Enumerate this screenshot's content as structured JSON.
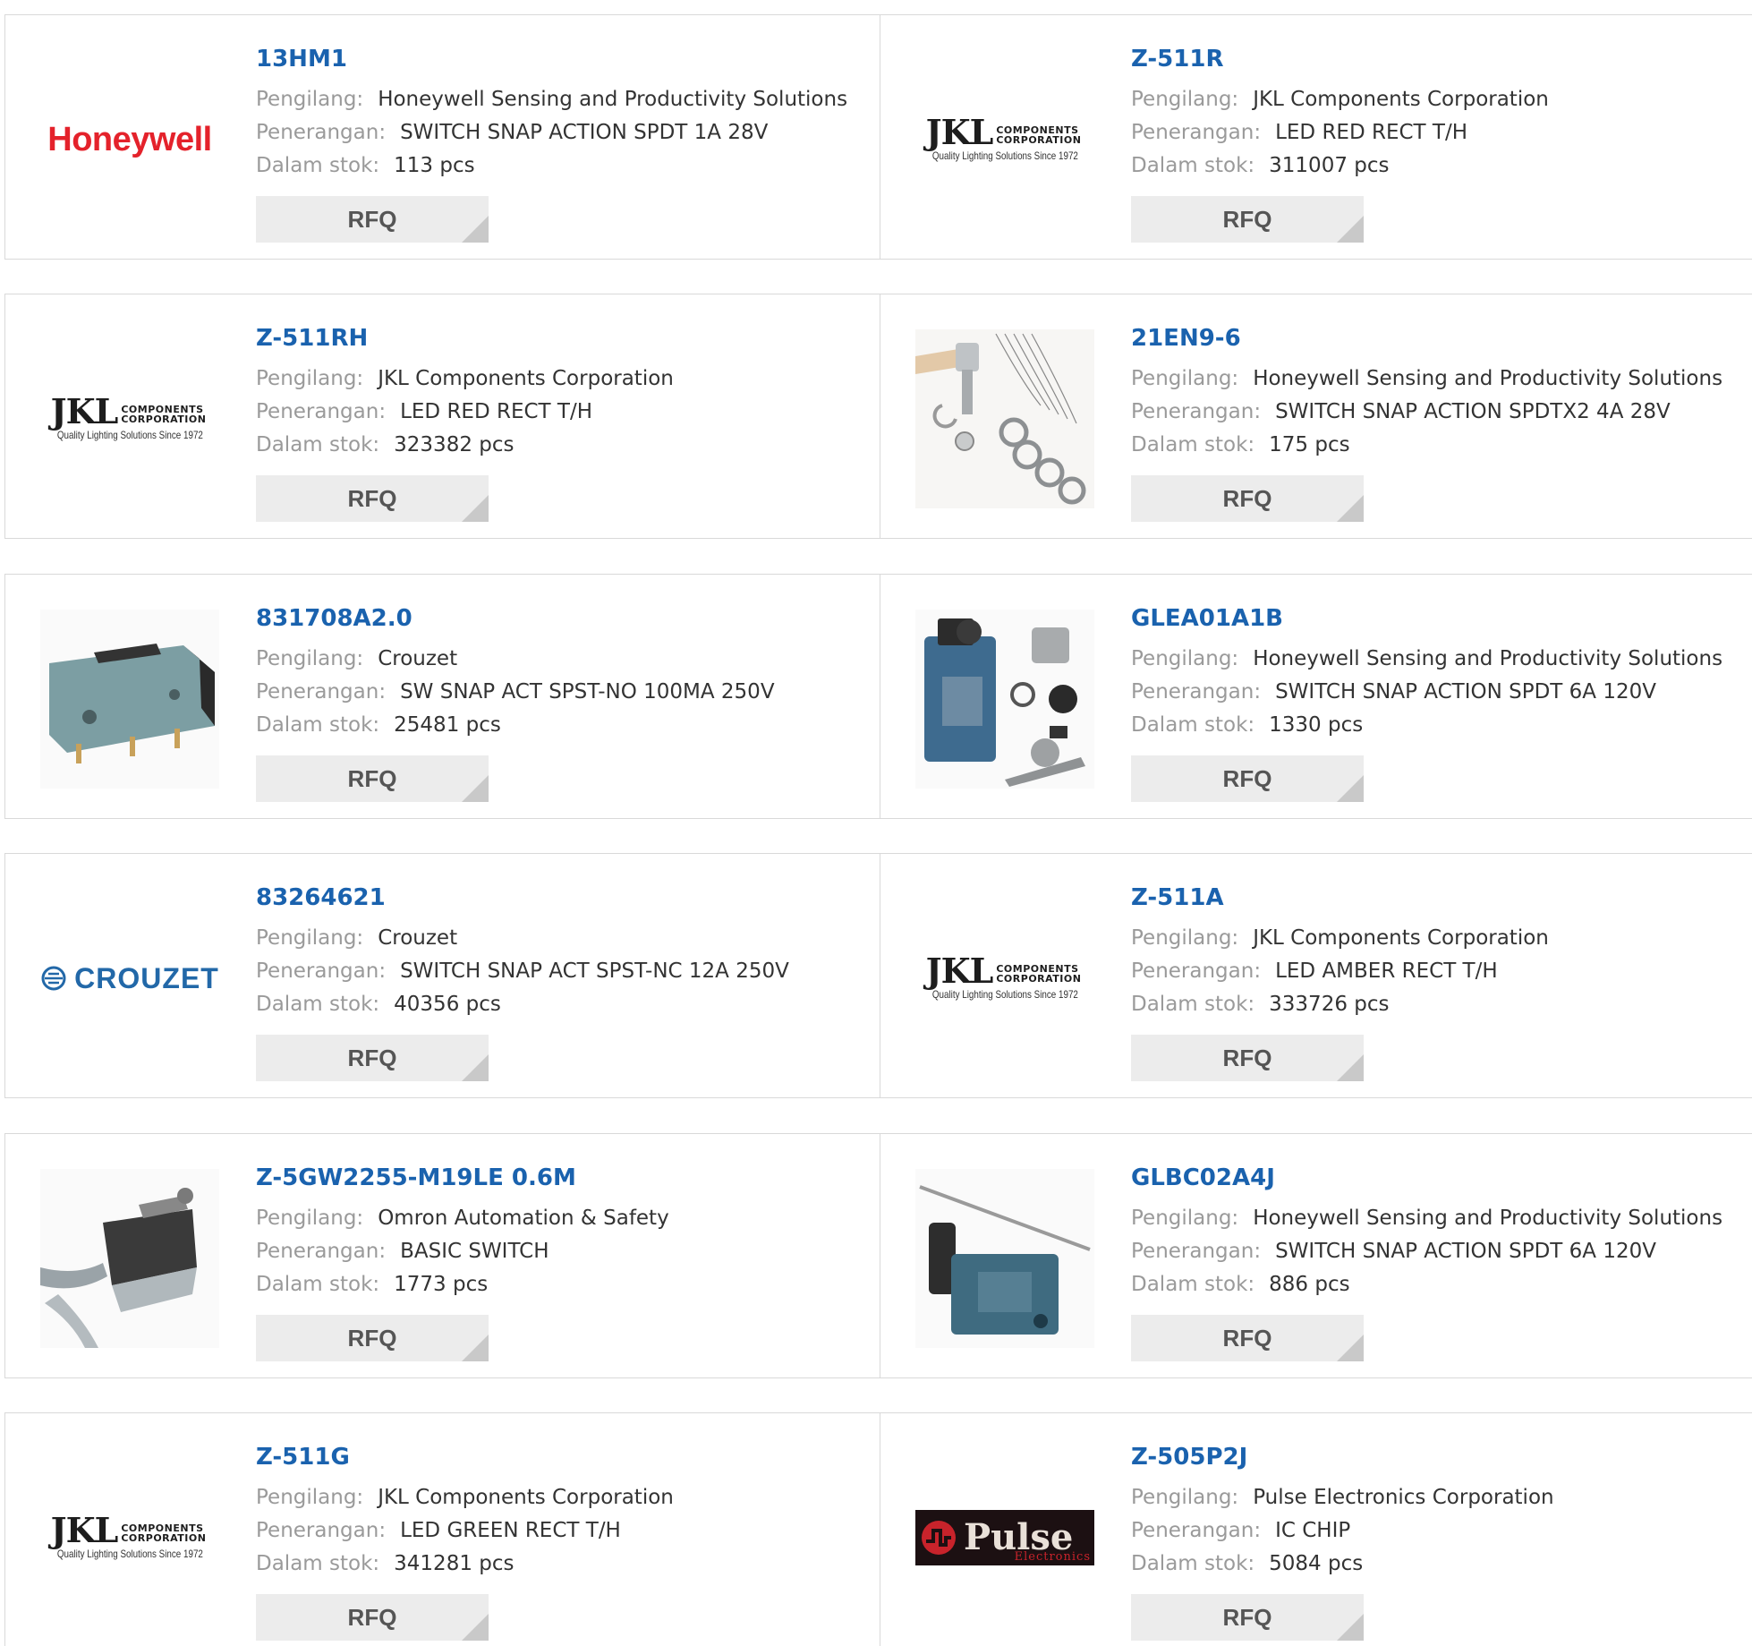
{
  "labels": {
    "manufacturer": "Pengilang:",
    "description": "Penerangan:",
    "stock": "Dalam stok:",
    "rfq": "RFQ"
  },
  "products": [
    {
      "part": "13HM1",
      "manufacturer": "Honeywell Sensing and Productivity Solutions",
      "description": "SWITCH SNAP ACTION SPDT 1A 28V",
      "stock": "113 pcs",
      "image": "honeywell-logo",
      "brand_text": "Honeywell"
    },
    {
      "part": "Z-511R",
      "manufacturer": "JKL Components Corporation",
      "description": "LED RED RECT T/H",
      "stock": "311007 pcs",
      "image": "jkl-logo",
      "brand_text": "JKL",
      "brand_sub": "COMPONENTS CORPORATION",
      "brand_tag": "Quality Lighting Solutions Since 1972"
    },
    {
      "part": "Z-511RH",
      "manufacturer": "JKL Components Corporation",
      "description": "LED RED RECT T/H",
      "stock": "323382 pcs",
      "image": "jkl-logo",
      "brand_text": "JKL",
      "brand_sub": "COMPONENTS CORPORATION",
      "brand_tag": "Quality Lighting Solutions Since 1972"
    },
    {
      "part": "21EN9-6",
      "manufacturer": "Honeywell Sensing and Productivity Solutions",
      "description": "SWITCH SNAP ACTION SPDTX2 4A 28V",
      "stock": "175 pcs",
      "image": "switch-kit-photo"
    },
    {
      "part": "831708A2.0",
      "manufacturer": "Crouzet",
      "description": "SW SNAP ACT SPST-NO 100MA 250V",
      "stock": "25481 pcs",
      "image": "microswitch-photo"
    },
    {
      "part": "GLEA01A1B",
      "manufacturer": "Honeywell Sensing and Productivity Solutions",
      "description": "SWITCH SNAP ACTION SPDT 6A 120V",
      "stock": "1330 pcs",
      "image": "limit-switch-kit-photo"
    },
    {
      "part": "83264621",
      "manufacturer": "Crouzet",
      "description": "SWITCH SNAP ACT SPST-NC 12A 250V",
      "stock": "40356 pcs",
      "image": "crouzet-logo",
      "brand_text": "CROUZET"
    },
    {
      "part": "Z-511A",
      "manufacturer": "JKL Components Corporation",
      "description": "LED AMBER RECT T/H",
      "stock": "333726 pcs",
      "image": "jkl-logo",
      "brand_text": "JKL",
      "brand_sub": "COMPONENTS CORPORATION",
      "brand_tag": "Quality Lighting Solutions Since 1972"
    },
    {
      "part": "Z-5GW2255-M19LE 0.6M",
      "manufacturer": "Omron Automation & Safety",
      "description": "BASIC SWITCH",
      "stock": "1773 pcs",
      "image": "roller-switch-photo"
    },
    {
      "part": "GLBC02A4J",
      "manufacturer": "Honeywell Sensing and Productivity Solutions",
      "description": "SWITCH SNAP ACTION SPDT 6A 120V",
      "stock": "886 pcs",
      "image": "rod-limit-switch-photo"
    },
    {
      "part": "Z-511G",
      "manufacturer": "JKL Components Corporation",
      "description": "LED GREEN RECT T/H",
      "stock": "341281 pcs",
      "image": "jkl-logo",
      "brand_text": "JKL",
      "brand_sub": "COMPONENTS CORPORATION",
      "brand_tag": "Quality Lighting Solutions Since 1972"
    },
    {
      "part": "Z-505P2J",
      "manufacturer": "Pulse Electronics Corporation",
      "description": "IC CHIP",
      "stock": "5084 pcs",
      "image": "pulse-logo",
      "brand_text": "Pulse",
      "brand_sub": "Electronics"
    }
  ],
  "colors": {
    "part_link": "#1a62ae",
    "label": "#9a9a9a",
    "value": "#333333",
    "rfq_bg": "#ececec",
    "border": "#d9d9d9"
  }
}
